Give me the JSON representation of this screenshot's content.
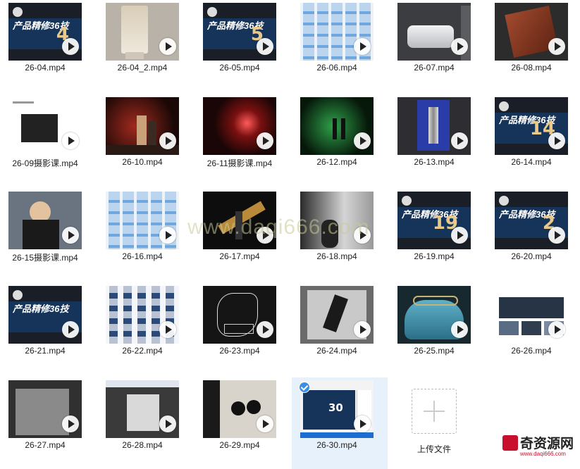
{
  "files": [
    {
      "name": "26-04.mp4",
      "thumb": "banner-navy",
      "num": "4"
    },
    {
      "name": "26-04_2.mp4",
      "thumb": "bb-cream"
    },
    {
      "name": "26-05.mp4",
      "thumb": "banner-navy",
      "num": "5"
    },
    {
      "name": "26-06.mp4",
      "thumb": "folders-blue"
    },
    {
      "name": "26-07.mp4",
      "thumb": "jar-dark"
    },
    {
      "name": "26-08.mp4",
      "thumb": "wood-brown"
    },
    {
      "name": "26-09摄影课.mp4",
      "thumb": "doc-white"
    },
    {
      "name": "26-10.mp4",
      "thumb": "bottles-red"
    },
    {
      "name": "26-11摄影课.mp4",
      "thumb": "red-light"
    },
    {
      "name": "26-12.mp4",
      "thumb": "earphone-green"
    },
    {
      "name": "26-13.mp4",
      "thumb": "bottle-purple"
    },
    {
      "name": "26-14.mp4",
      "thumb": "banner-navy",
      "num": "14"
    },
    {
      "name": "26-15摄影课.mp4",
      "thumb": "person-studio"
    },
    {
      "name": "26-16.mp4",
      "thumb": "folders-blue"
    },
    {
      "name": "26-17.mp4",
      "thumb": "ribbon-dark"
    },
    {
      "name": "26-18.mp4",
      "thumb": "grey-object"
    },
    {
      "name": "26-19.mp4",
      "thumb": "banner-navy",
      "num": "19"
    },
    {
      "name": "26-20.mp4",
      "thumb": "banner-navy",
      "num": "2"
    },
    {
      "name": "26-21.mp4",
      "thumb": "banner-navy",
      "num": ""
    },
    {
      "name": "26-22.mp4",
      "thumb": "files-docs"
    },
    {
      "name": "26-23.mp4",
      "thumb": "sketch-dark"
    },
    {
      "name": "26-24.mp4",
      "thumb": "sketch-grey"
    },
    {
      "name": "26-25.mp4",
      "thumb": "purse-blue"
    },
    {
      "name": "26-26.mp4",
      "thumb": "web-grid"
    },
    {
      "name": "26-27.mp4",
      "thumb": "grey-app"
    },
    {
      "name": "26-28.mp4",
      "thumb": "ps-app"
    },
    {
      "name": "26-29.mp4",
      "thumb": "studio-lights"
    },
    {
      "name": "26-30.mp4",
      "thumb": "banner-screen",
      "num": "30",
      "selected": true
    }
  ],
  "banner_text": "产品精修36技",
  "upload_label": "上传文件",
  "watermark": "www.daqi666.com",
  "logo": {
    "text": "奇资源网",
    "url": "www.daqi666.com"
  }
}
